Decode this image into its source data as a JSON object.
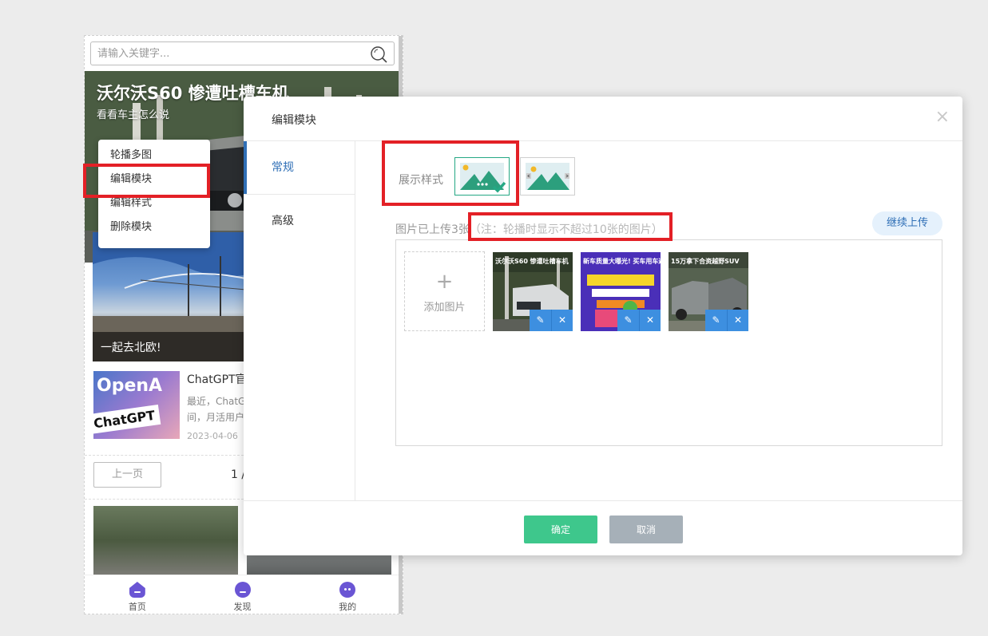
{
  "phone": {
    "search_placeholder": "请输入关键字...",
    "banner_title": "沃尔沃S60  惨遭吐槽车机",
    "banner_subtitle": "看看车主怎么说",
    "context_menu": [
      "轮播多图",
      "编辑模块",
      "编辑样式",
      "删除模块"
    ],
    "card_caption": "一起去北欧!",
    "news": {
      "thumb_logo": "OpenA",
      "thumb_sign": "ChatGPT",
      "title": "ChatGPT官",
      "desc": "最近，ChatG间，月活用户",
      "date": "2023-04-06"
    },
    "pager": {
      "prev": "上一页",
      "page": "1 /"
    },
    "tabbar": [
      {
        "label": "首页",
        "icon": "home-icon"
      },
      {
        "label": "发现",
        "icon": "discover-icon"
      },
      {
        "label": "我的",
        "icon": "profile-icon"
      }
    ]
  },
  "dialog": {
    "title": "编辑模块",
    "close": "×",
    "tabs": [
      "常规",
      "高级"
    ],
    "active_tab": "常规",
    "style_label": "展示样式",
    "upload_info": "图片已上传3张",
    "upload_note": "（注：轮播时显示不超过10张的图片）",
    "continue_upload": "继续上传",
    "add_image": "添加图片",
    "images": [
      {
        "caption": "沃尔沃S60 惨遭吐槽车机"
      },
      {
        "caption": "新车质量大曝光! 买车用车避坑指南"
      },
      {
        "caption": "15万拿下合资越野SUV"
      }
    ],
    "confirm": "确定",
    "cancel": "取消"
  },
  "colors": {
    "accent_blue": "#2f6fb6",
    "confirm_green": "#3ec78c",
    "cancel_gray": "#a6b0b8",
    "highlight_red": "#e32026",
    "thumb_action_blue": "#3d8fe0"
  }
}
